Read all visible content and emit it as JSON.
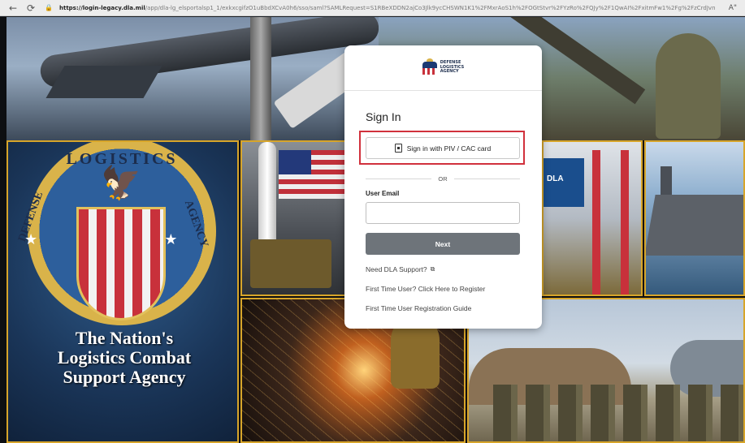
{
  "browser": {
    "back_icon": "←",
    "reload_icon": "⟳",
    "lock_icon": "🔒",
    "url_domain": "https://login-legacy.dla.mil",
    "url_rest": "/app/dla-lg_elsportalsp1_1/exkxcgifzO1uBbdXCvA0h6/sso/saml?SAMLRequest=S1RBeXDDN2ajCo3Jlk9ycCHSWN1K1%2FMxrAoS1h%2FOGtStvr%2FYzRo%2FQJy%2F1QwAI%2FxitmFw1%2Fg%2FzCrdJvn",
    "right_label": "A\""
  },
  "hero": {
    "tagline_line1": "The Nation's",
    "tagline_line2": "Logistics Combat",
    "tagline_line3": "Support Agency",
    "seal_top": "LOGISTICS",
    "seal_left": "DEFENSE",
    "seal_right": "AGENCY",
    "tile_dla_banner": "DLA"
  },
  "login": {
    "logo_line1": "DEFENSE",
    "logo_line2": "LOGISTICS",
    "logo_line3": "AGENCY",
    "title": "Sign In",
    "piv_button": "Sign in with PIV / CAC card",
    "or_text": "OR",
    "email_label": "User Email",
    "email_value": "",
    "next_button": "Next",
    "support_link": "Need DLA Support?",
    "register_link": "First Time User? Click Here to Register",
    "guide_link": "First Time User Registration Guide"
  },
  "colors": {
    "highlight": "#d1313c",
    "next_button_bg": "#6e747a",
    "gold_border": "#d7a52a"
  }
}
